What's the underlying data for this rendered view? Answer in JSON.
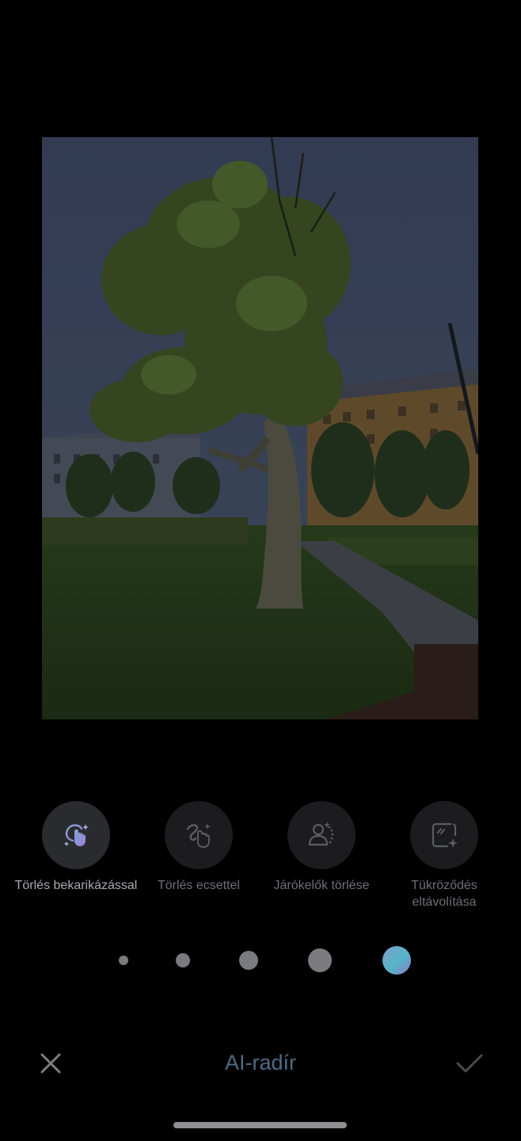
{
  "editor": {
    "title": "AI-radír",
    "cancel_icon": "close-icon",
    "confirm_icon": "check-icon"
  },
  "tools": [
    {
      "label": "Törlés bekarikázással",
      "icon": "circle-erase-icon",
      "active": true
    },
    {
      "label": "Törlés ecsettel",
      "icon": "brush-erase-icon",
      "active": false
    },
    {
      "label": "Járókelők törlése",
      "icon": "remove-people-icon",
      "active": false
    },
    {
      "label": "Tükröződés eltávolítása",
      "icon": "remove-reflection-icon",
      "active": false
    }
  ],
  "brush_sizes": [
    "extra-small",
    "small",
    "medium",
    "large",
    "auto-gradient"
  ],
  "colors": {
    "background": "#000000",
    "accent": "#4f6b86",
    "tool_circle": "#1c1c1e"
  }
}
